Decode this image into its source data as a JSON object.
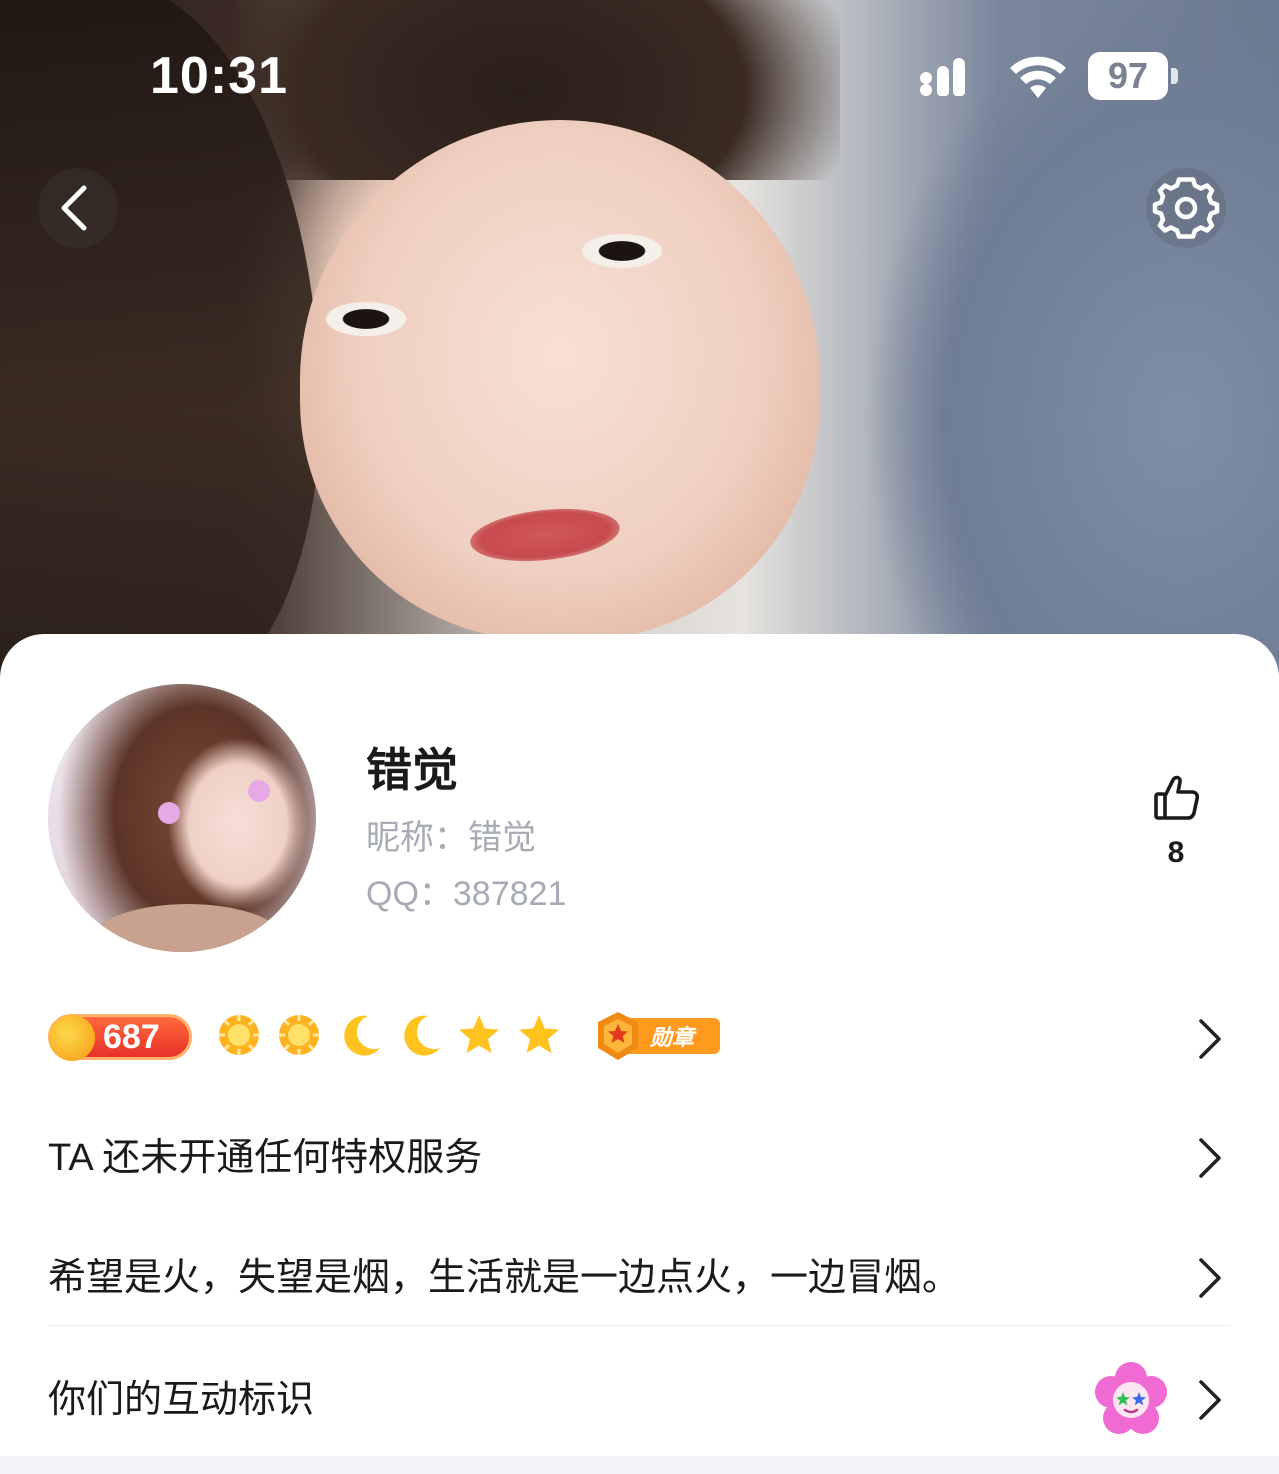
{
  "status_bar": {
    "time": "10:31",
    "battery": "97"
  },
  "nav": {
    "back_icon": "chevron-left-icon",
    "settings_icon": "gear-icon"
  },
  "profile": {
    "name": "错觉",
    "nickname": "昵称：错觉",
    "qq": "QQ：387821",
    "likes": "8"
  },
  "level": {
    "value": "687",
    "icons": [
      "sun",
      "sun",
      "moon",
      "moon",
      "star",
      "star"
    ],
    "medal_label": "勋章"
  },
  "rows": {
    "privilege": "TA 还未开通任何特权服务",
    "signature": "希望是火，失望是烟，生活就是一边点火，一边冒烟。",
    "interaction": "你们的互动标识"
  },
  "colors": {
    "level_badge": "#e8312a",
    "gold": "#f5b41a",
    "medal": "#ff9a1f"
  }
}
